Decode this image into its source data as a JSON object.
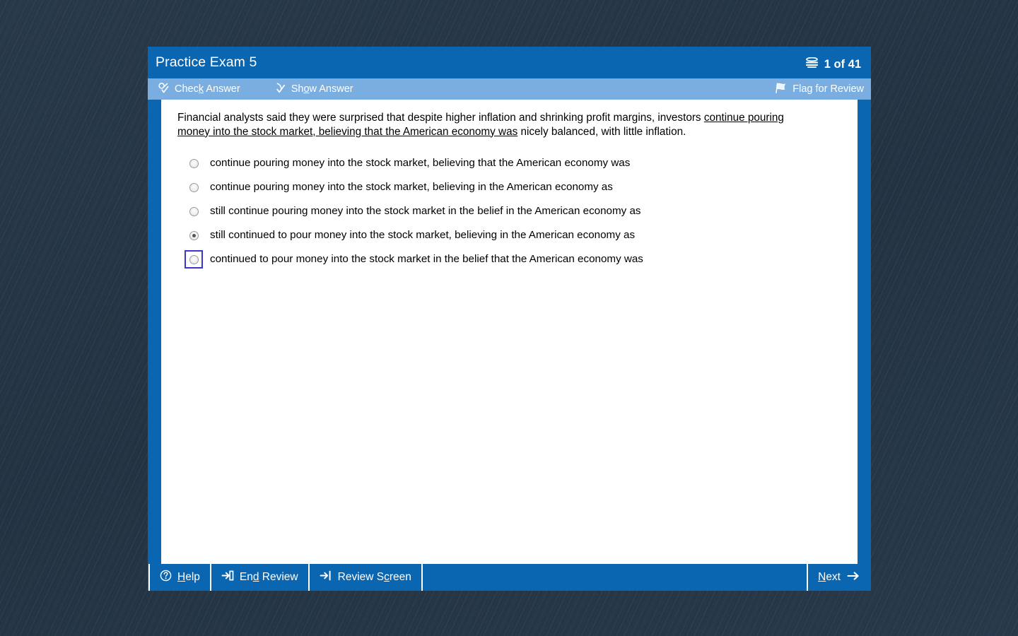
{
  "window": {
    "title": "Practice Exam 5",
    "page_counter": "1 of 41",
    "pages_icon": "stacked-pages-icon"
  },
  "answer_toolbar": {
    "check_answer": {
      "label_before": "Chec",
      "accel": "k",
      "label_after": " Answer",
      "icon": "pencil-check-icon"
    },
    "show_answer": {
      "label_before": "Sh",
      "accel": "o",
      "label_after": "w Answer",
      "icon": "check-mark-icon"
    },
    "flag_for_review": {
      "label": "Flag for Review",
      "icon": "flag-icon"
    }
  },
  "question": {
    "text_before": "Financial analysts said they were surprised that despite higher inflation and shrinking profit margins, investors ",
    "underlined": "continue pouring money into the stock market, believing that the American economy was",
    "text_after": " nicely balanced, with little inflation.",
    "options": [
      {
        "label": "continue pouring money into the stock market, believing that the American economy was",
        "selected": false,
        "focused": false
      },
      {
        "label": "continue pouring money into the stock market, believing in the American economy as",
        "selected": false,
        "focused": false
      },
      {
        "label": "still continue pouring money into the stock market in the belief in the American economy as",
        "selected": false,
        "focused": false
      },
      {
        "label": "still continued to pour money into the stock market, believing in the American economy as",
        "selected": true,
        "focused": false
      },
      {
        "label": "continued to pour money into the stock market in the belief that the American economy was",
        "selected": false,
        "focused": true
      }
    ]
  },
  "bottom_bar": {
    "help": {
      "label_before": "",
      "accel": "H",
      "label_after": "elp",
      "icon": "question-circle-icon"
    },
    "end_review": {
      "label_before": "En",
      "accel": "d",
      "label_after": " Review",
      "icon": "arrow-into-box-icon"
    },
    "review_screen": {
      "label_before": "Review S",
      "accel": "c",
      "label_after": "reen",
      "icon": "arrow-to-bar-icon"
    },
    "next": {
      "label_before": "",
      "accel": "N",
      "label_after": "ext",
      "icon": "arrow-right-icon"
    }
  },
  "colors": {
    "title_bar": "#0b66b2",
    "toolbar": "#7aaee0",
    "desktop_background": "#253745",
    "focus_ring": "#3b38c8"
  }
}
